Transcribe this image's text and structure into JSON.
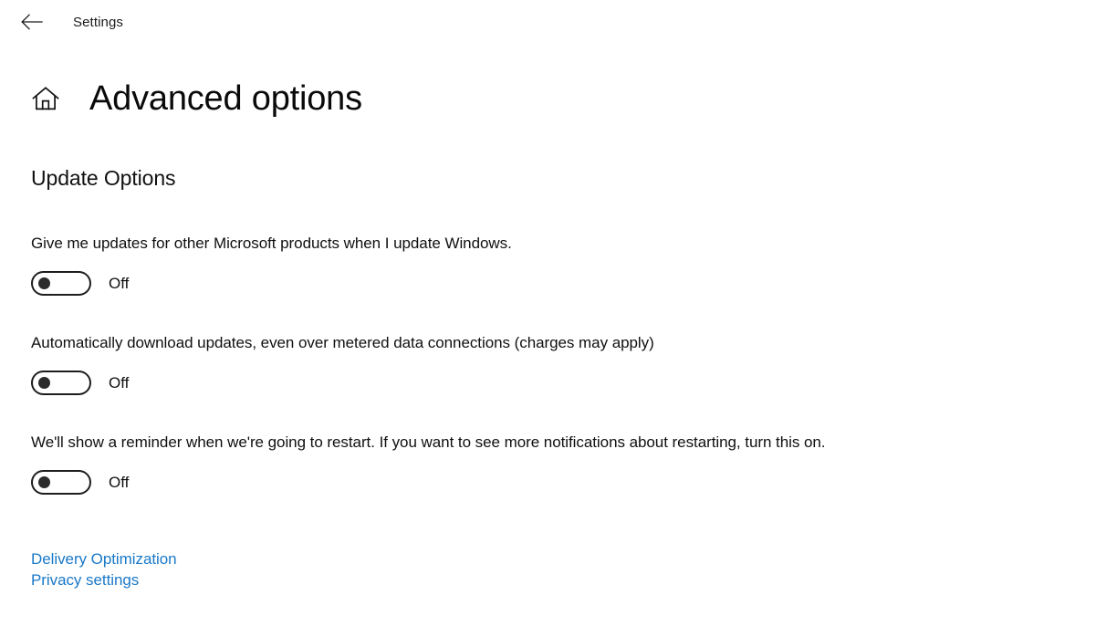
{
  "window": {
    "titlebar": {
      "back_label": "Back",
      "back_icon": "arrow-left-icon",
      "title": "Settings"
    }
  },
  "header": {
    "home_icon": "home-icon",
    "title": "Advanced options"
  },
  "main": {
    "section_heading": "Update Options",
    "options": [
      {
        "label": "Give me updates for other Microsoft products when I update Windows.",
        "state_label": "Off",
        "state": "off"
      },
      {
        "label": "Automatically download updates, even over metered data connections (charges may apply)",
        "state_label": "Off",
        "state": "off"
      },
      {
        "label": "We'll show a reminder when we're going to restart. If you want to see more notifications about restarting, turn this on.",
        "state_label": "Off",
        "state": "off"
      }
    ],
    "links": [
      {
        "label": "Delivery Optimization"
      },
      {
        "label": "Privacy settings"
      }
    ]
  },
  "colors": {
    "background": "#ffffff",
    "text": "#101010",
    "link": "#1a79c8",
    "toggle_border": "#1d1d1d",
    "toggle_knob": "#2b2b2b"
  }
}
